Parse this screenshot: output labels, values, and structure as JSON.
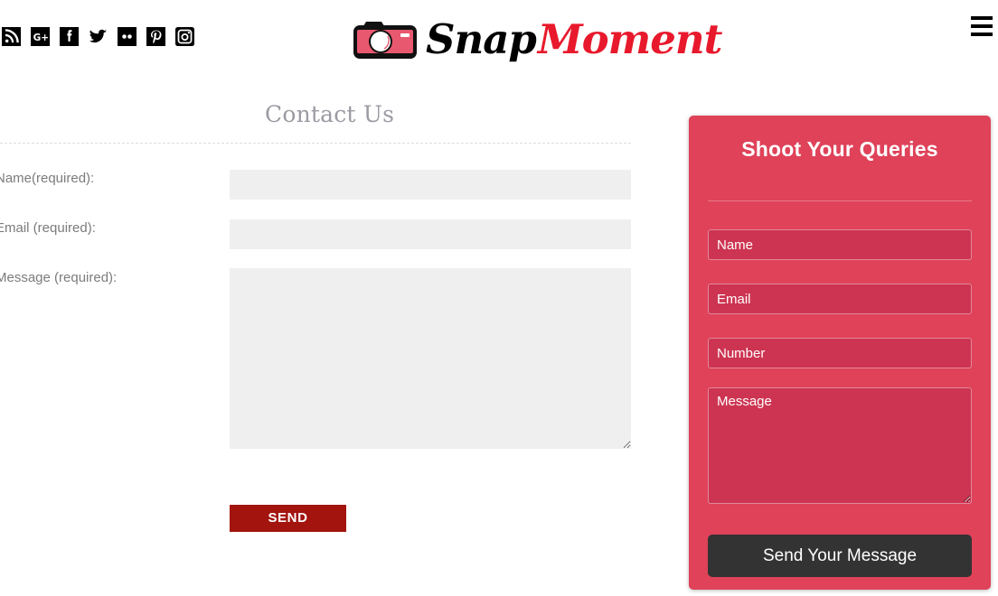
{
  "header": {
    "social_links": [
      {
        "name": "rss",
        "label": "RSS"
      },
      {
        "name": "google-plus",
        "label": "Google Plus"
      },
      {
        "name": "facebook",
        "label": "Facebook"
      },
      {
        "name": "twitter",
        "label": "Twitter"
      },
      {
        "name": "flickr",
        "label": "Flickr"
      },
      {
        "name": "pinterest",
        "label": "Pinterest"
      },
      {
        "name": "instagram",
        "label": "Instagram"
      }
    ],
    "logo": {
      "part_one": "Snap",
      "part_two": "Moment",
      "icon": "camera-icon",
      "color_one": "#000000",
      "color_two": "#e8192c"
    },
    "menu_icon": "hamburger-menu-icon"
  },
  "contact_form": {
    "title": "Contact Us",
    "fields": [
      {
        "label": "Name(required):",
        "value": "",
        "type": "text"
      },
      {
        "label": "Email  (required):",
        "value": "",
        "type": "text"
      },
      {
        "label": "Message  (required):",
        "value": "",
        "type": "textarea"
      }
    ],
    "submit_label": "SEND",
    "submit_color": "#a3140f",
    "input_background": "#efefef"
  },
  "queries_panel": {
    "title": "Shoot Your Queries",
    "panel_color": "#df4259",
    "field_color": "#cd3451",
    "fields": [
      {
        "placeholder": "Name",
        "value": ""
      },
      {
        "placeholder": "Email",
        "value": ""
      },
      {
        "placeholder": "Number",
        "value": ""
      },
      {
        "placeholder": "Message",
        "value": ""
      }
    ],
    "submit_label": "Send Your Message",
    "submit_color": "#333333"
  }
}
